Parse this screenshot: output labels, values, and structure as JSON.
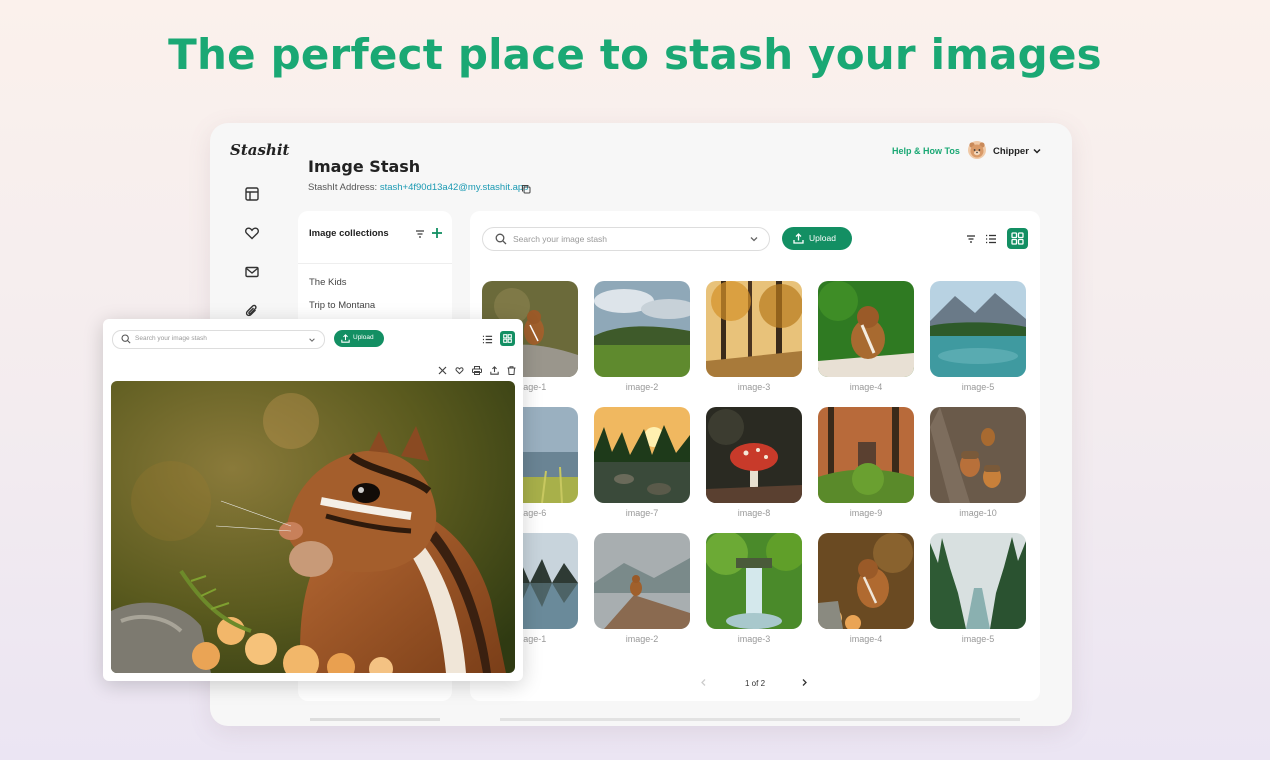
{
  "hero": {
    "headline": "The perfect place to stash your images"
  },
  "app": {
    "logo": "Stashit",
    "page_title": "Image Stash",
    "address_label": "StashIt Address: ",
    "address_value": "stash+4f90d13a42@my.stashit.app",
    "help_link": "Help & How Tos",
    "user_name": "Chipper"
  },
  "sidebar": {
    "icons": [
      "layout-icon",
      "heart-icon",
      "mail-icon",
      "paperclip-icon"
    ]
  },
  "collections": {
    "title": "Image collections",
    "items": [
      "The Kids",
      "Trip to Montana"
    ]
  },
  "toolbar": {
    "search_placeholder": "Search your image stash",
    "upload_label": "Upload"
  },
  "gallery": {
    "items": [
      {
        "label": "image-1",
        "theme": "chipmunk-rock"
      },
      {
        "label": "image-2",
        "theme": "meadow"
      },
      {
        "label": "image-3",
        "theme": "autumn-forest"
      },
      {
        "label": "image-4",
        "theme": "chipmunk-green"
      },
      {
        "label": "image-5",
        "theme": "mountain-lake"
      },
      {
        "label": "image-6",
        "theme": "lake-grass"
      },
      {
        "label": "image-7",
        "theme": "river-sunset"
      },
      {
        "label": "image-8",
        "theme": "mushroom"
      },
      {
        "label": "image-9",
        "theme": "mossy-forest"
      },
      {
        "label": "image-10",
        "theme": "acorns"
      },
      {
        "label": "image-1",
        "theme": "misty-lake"
      },
      {
        "label": "image-2",
        "theme": "chipmunk-log"
      },
      {
        "label": "image-3",
        "theme": "waterfall"
      },
      {
        "label": "image-4",
        "theme": "chipmunk-autumn"
      },
      {
        "label": "image-5",
        "theme": "forest-river"
      }
    ]
  },
  "pagination": {
    "text": "1 of 2"
  },
  "viewer": {
    "search_placeholder": "Search your image stash",
    "upload_label": "Upload",
    "image_theme": "chipmunk-closeup"
  },
  "colors": {
    "accent": "#1aa874",
    "button": "#138f63",
    "link": "#1b9ab3"
  }
}
